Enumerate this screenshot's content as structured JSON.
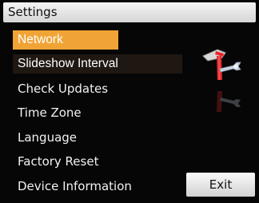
{
  "title": "Settings",
  "menu": {
    "items": [
      {
        "label": "Network"
      },
      {
        "label": "Slideshow Interval"
      },
      {
        "label": "Check Updates"
      },
      {
        "label": "Time Zone"
      },
      {
        "label": "Language"
      },
      {
        "label": "Factory Reset"
      },
      {
        "label": "Device Information"
      }
    ],
    "selected_index": 0,
    "focused_index": 1
  },
  "exit_label": "Exit",
  "icons": {
    "tools": "tools-icon"
  },
  "colors": {
    "selected_bg": "#f1a436",
    "focused_bg": "#1e1712",
    "background": "#060606"
  }
}
